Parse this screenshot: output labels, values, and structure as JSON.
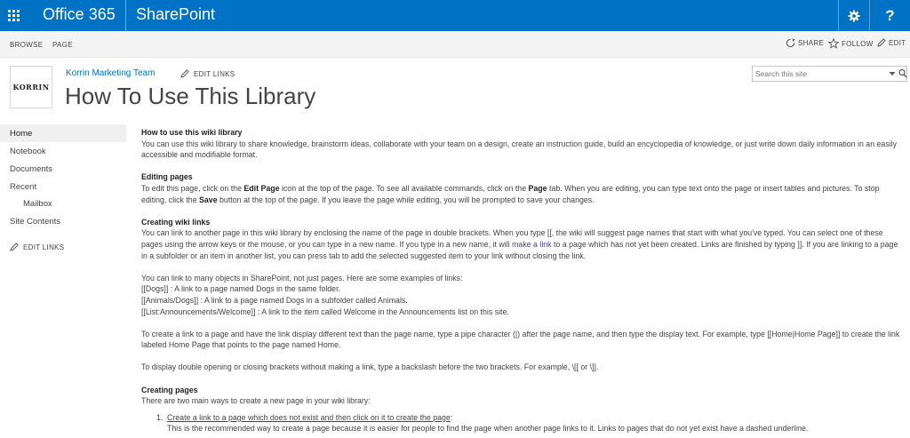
{
  "suite_bar": {
    "brand": "Office 365",
    "app": "SharePoint",
    "help_label": "?"
  },
  "ribbon": {
    "tabs": [
      "BROWSE",
      "PAGE"
    ],
    "share": "SHARE",
    "follow": "FOLLOW",
    "edit": "EDIT"
  },
  "header": {
    "logo_text": "KORRIN",
    "site_link": "Korrin Marketing Team",
    "edit_links": "EDIT LINKS",
    "page_title": "How To Use This Library",
    "search_placeholder": "Search this site"
  },
  "left_nav": {
    "items": [
      "Home",
      "Notebook",
      "Documents",
      "Recent",
      "Mailbox",
      "Site Contents"
    ],
    "edit_links": "EDIT LINKS"
  },
  "content": {
    "s1_heading": "How to use this wiki library",
    "s1_text": "You can use this wiki library to share knowledge, brainstorm ideas, collaborate with your team on a design, create an instruction guide, build an encyclopedia of knowledge, or just write down daily information in an easily accessible and modifiable format.",
    "s2_heading": "Editing pages",
    "s2_p1": "To edit this page, click on the ",
    "s2_b1": "Edit Page",
    "s2_p2": " icon at the top of the page. To see all available commands, click on the ",
    "s2_b2": "Page",
    "s2_p3": " tab. When you are editing, you can type text onto the page or insert tables and pictures. To stop editing, click the ",
    "s2_b3": "Save",
    "s2_p4": " button at the top of the page. If you leave the page while editing, you will be prompted to save your changes.",
    "s3_heading": "Creating wiki links",
    "s3_p1": "You can link to another page in this wiki library by enclosing the name of the page in double brackets. When you type [[, the wiki will suggest page names that start with what you've typed. You can select one of these pages using the arrow keys or the mouse, or you can type in a new name. If you type in a new name, it will ",
    "s3_link": "make a link",
    "s3_p2": " to a page which has not yet been created. Links are finished by typing ]]. If you are linking to a page in a subfolder or an item in another list, you can press tab to add the selected suggested item to your link without closing the link.",
    "s4_intro": "You can link to many objects in SharePoint, not just pages. Here are some examples of links:",
    "s4_ex1": "[[Dogs]] : A link to a page named Dogs in the same folder.",
    "s4_ex2": "[[Animals/Dogs]] : A link to a page named Dogs in a subfolder called Animals.",
    "s4_ex3": "[[List:Announcements/Welcome]] : A link to the item called Welcome in the Announcements list on this site.",
    "s5_text": "To create a link to a page and have the link display different text than the page name, type a pipe character (|) after the page name, and then type the display text. For example, type [[Home|Home Page]] to create the link labeled Home Page that points to the page named Home.",
    "s6_text": "To display double opening or closing brackets without making a link, type a backslash before the two brackets. For example, \\[[ or \\]].",
    "s7_heading": "Creating pages",
    "s7_intro": "There are two main ways to create a new page in your wiki library:",
    "s7_item1_num": "1.",
    "s7_item1_title": "Create a link to a page which does not exist and then click on it to create the page",
    "s7_item1_colon": ":",
    "s7_item1_text": "This is the recommended way to create a page because it is easier for people to find the page when another page links to it. Links to pages that do not yet exist have a dashed underline."
  },
  "colors": {
    "suite_bar": "#0072c6",
    "link": "#0072c6",
    "inline_link": "#4c3fa0",
    "ribbon_bg": "#f4f4f4",
    "nav_selected_bg": "#f0f0f0"
  },
  "icons": [
    "waffle-icon",
    "gear-icon",
    "help-icon",
    "share-icon",
    "star-icon",
    "pencil-icon",
    "search-icon",
    "dropdown-caret-icon"
  ]
}
